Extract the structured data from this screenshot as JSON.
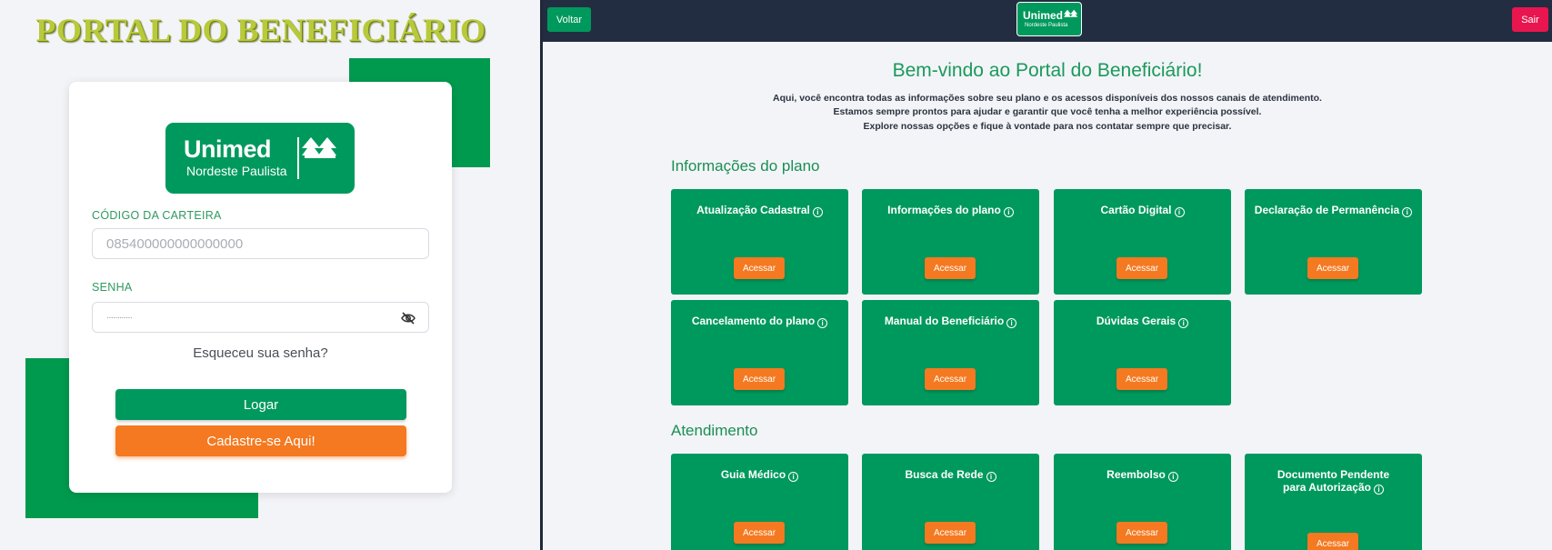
{
  "login": {
    "portal_title": "PORTAL DO BENEFICIÁRIO",
    "logo_brand": "Unimed",
    "logo_sub": "Nordeste Paulista",
    "card_label": "CÓDIGO DA CARTEIRA",
    "card_value": "085400000000000000",
    "password_label": "SENHA",
    "password_value": "············",
    "forgot": "Esqueceu sua senha?",
    "login_button": "Logar",
    "register_button": "Cadastre-se Aqui!"
  },
  "portal": {
    "back_button": "Voltar",
    "exit_button": "Sair",
    "logo_brand": "Unimed",
    "logo_sub": "Nordeste Paulista",
    "welcome": "Bem-vindo ao Portal do Beneficiário!",
    "intro_lines": [
      "Aqui, você encontra todas as informações sobre seu plano e os acessos disponíveis dos nossos canais de atendimento.",
      "Estamos sempre prontos para ajudar e garantir que você tenha a melhor experiência possível.",
      "Explore nossas opções e fique à vontade para nos contatar sempre que precisar."
    ],
    "sections": [
      {
        "title": "Informações do plano",
        "cards": [
          {
            "title": "Atualização Cadastral",
            "button": "Acessar"
          },
          {
            "title": "Informações do plano",
            "button": "Acessar"
          },
          {
            "title": "Cartão Digital",
            "button": "Acessar"
          },
          {
            "title": "Declaração de Permanência",
            "button": "Acessar"
          },
          {
            "title": "Cancelamento do plano",
            "button": "Acessar"
          },
          {
            "title": "Manual do Beneficiário",
            "button": "Acessar"
          },
          {
            "title": "Dúvidas Gerais",
            "button": "Acessar"
          }
        ]
      },
      {
        "title": "Atendimento",
        "cards": [
          {
            "title": "Guia Médico",
            "button": "Acessar"
          },
          {
            "title": "Busca de Rede",
            "button": "Acessar"
          },
          {
            "title": "Reembolso",
            "button": "Acessar"
          },
          {
            "title": "Documento Pendente para Autorização",
            "button": "Acessar"
          }
        ]
      }
    ],
    "info_glyph": "i"
  },
  "colors": {
    "brand_green": "#00995d",
    "accent_orange": "#f47920",
    "exit_red": "#e8154f",
    "topbar": "#232d42"
  }
}
